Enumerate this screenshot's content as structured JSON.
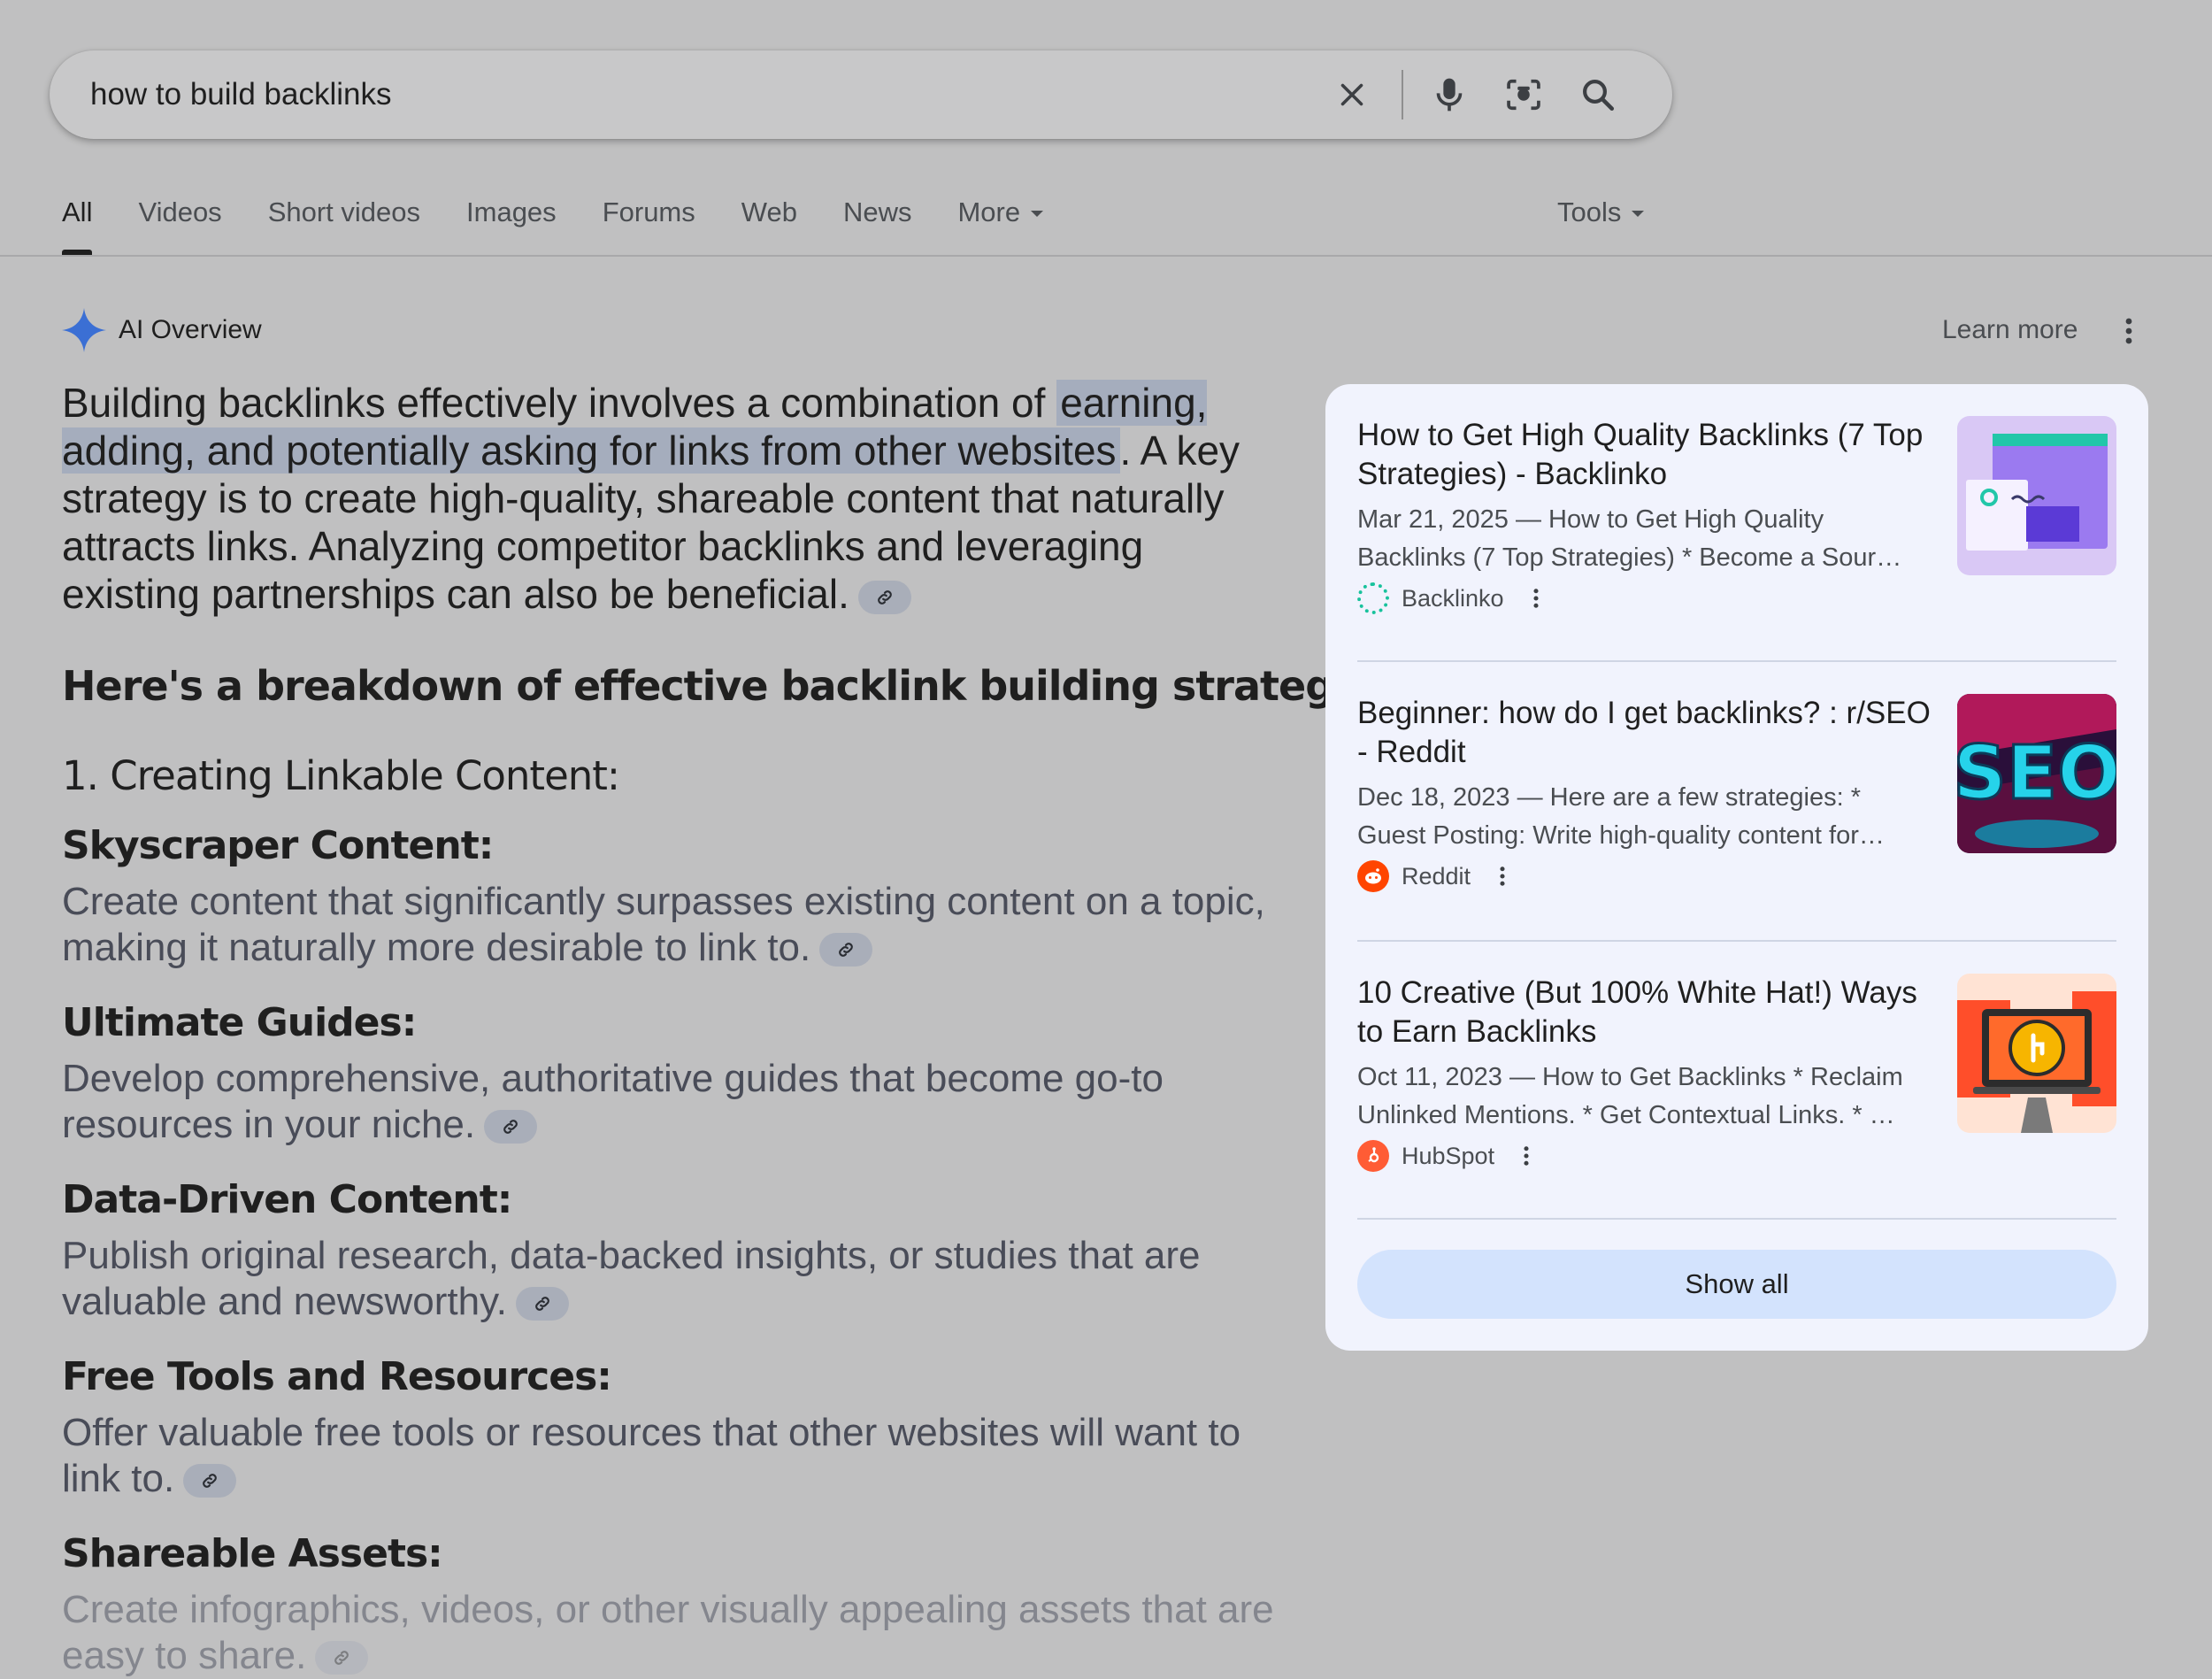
{
  "search": {
    "query": "how to build backlinks"
  },
  "tabs": [
    {
      "label": "All"
    },
    {
      "label": "Videos"
    },
    {
      "label": "Short videos"
    },
    {
      "label": "Images"
    },
    {
      "label": "Forums"
    },
    {
      "label": "Web"
    },
    {
      "label": "News"
    },
    {
      "label": "More"
    }
  ],
  "tools_label": "Tools",
  "ai_overview": {
    "title": "AI Overview",
    "learn_more": "Learn more",
    "intro_part1": "Building backlinks effectively involves a combination of ",
    "intro_highlight": "earning, adding, and potentially asking for links from other websites",
    "intro_part2": ". A key strategy is to create high-quality, shareable content that naturally attracts links. Analyzing competitor backlinks and leveraging existing partnerships can also be beneficial.",
    "breakdown_heading": "Here's a breakdown of effective backlink building strategies:",
    "section_heading": "1. Creating Linkable Content:",
    "items": [
      {
        "title": "Skyscraper Content:",
        "body": "Create content that significantly surpasses existing content on a topic, making it naturally more desirable to link to."
      },
      {
        "title": "Ultimate Guides:",
        "body": "Develop comprehensive, authoritative guides that become go-to resources in your niche."
      },
      {
        "title": "Data-Driven Content:",
        "body": "Publish original research, data-backed insights, or studies that are valuable and newsworthy."
      },
      {
        "title": "Free Tools and Resources:",
        "body": "Offer valuable free tools or resources that other websites will want to link to."
      },
      {
        "title": "Shareable Assets:",
        "body": "Create infographics, videos, or other visually appealing assets that are easy to share."
      }
    ]
  },
  "sources": [
    {
      "title": "How to Get High Quality Backlinks (7 Top Strategies) - Backlinko",
      "snippet": "Mar 21, 2025 — How to Get High Quality Backlinks (7 Top Strategies) * Become a Sour…",
      "source": "Backlinko"
    },
    {
      "title": "Beginner: how do I get backlinks? : r/SEO - Reddit",
      "snippet": "Dec 18, 2023 — Here are a few strategies: * Guest Posting: Write high-quality content for…",
      "source": "Reddit",
      "thumb_text": "SEO"
    },
    {
      "title": "10 Creative (But 100% White Hat!) Ways to Earn Backlinks",
      "snippet": "Oct 11, 2023 — How to Get Backlinks * Reclaim Unlinked Mentions. * Get Contextual Links. * …",
      "source": "HubSpot"
    }
  ],
  "show_all": "Show all",
  "colors": {
    "background": "#c0c0c1",
    "panel": "#f1f3fd",
    "highlight": "#a5adbd",
    "show_all_button": "#d3e3fd",
    "gemini_star": "#3b6fd4",
    "reddit": "#ff4500",
    "hubspot": "#ff5c35",
    "backlinko": "#18c29c"
  }
}
